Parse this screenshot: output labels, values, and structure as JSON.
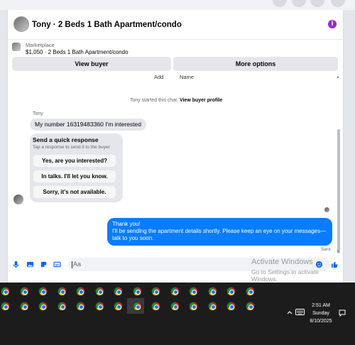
{
  "header": {
    "avatar_icon": "profile-photo-icon",
    "title": "Tony · 2 Beds 1 Bath Apartment/condo",
    "info_icon": "info-icon"
  },
  "listing": {
    "label": "Marketplace",
    "price_title": "$1,050 · 2 Beds 1 Bath Apartment/condo",
    "view_buyer_label": "View buyer",
    "more_options_label": "More options"
  },
  "conversation": {
    "cut_off_left": "Add",
    "cut_off_right": "Name",
    "system_text": "Tony started this chat.",
    "system_link": "View buyer profile",
    "sender_name": "Tony",
    "incoming_message": "My number 16319483360 I'm interested",
    "quick_reply": {
      "title": "Send a quick response",
      "subtitle": "Tap a response to send it to the buyer.",
      "options": [
        "Yes, are you interested?",
        "In talks. I'll let you know.",
        "Sorry, it's not available."
      ]
    },
    "outgoing_line1": "Thank you!",
    "outgoing_line2": "I'll be sending the apartment details shortly. Please keep an eye on your messages—",
    "outgoing_line3": "talk to you soon.",
    "status": "Sent"
  },
  "composer": {
    "placeholder": "Aa",
    "icons": [
      "microphone-icon",
      "photo-icon",
      "sticker-icon",
      "gif-icon",
      "emoji-icon",
      "thumbs-up-icon"
    ]
  },
  "watermark": {
    "line1": "Activate Windows",
    "line2": "Go to Settings to activate Windows."
  },
  "taskbar": {
    "app_icon": "chrome-icon",
    "row1_count": 14,
    "row2_count": 14,
    "tray_icons": [
      "chevron-up-icon",
      "keyboard-icon",
      "notifications-icon"
    ],
    "time": "2:51 AM",
    "day": "Sunday",
    "date": "8/10/2025"
  },
  "colors": {
    "accent": "#0866ff",
    "outgoing_bubble": "#0a7cff",
    "info_badge": "#a322d8",
    "taskbar": "#1c1c1c"
  }
}
